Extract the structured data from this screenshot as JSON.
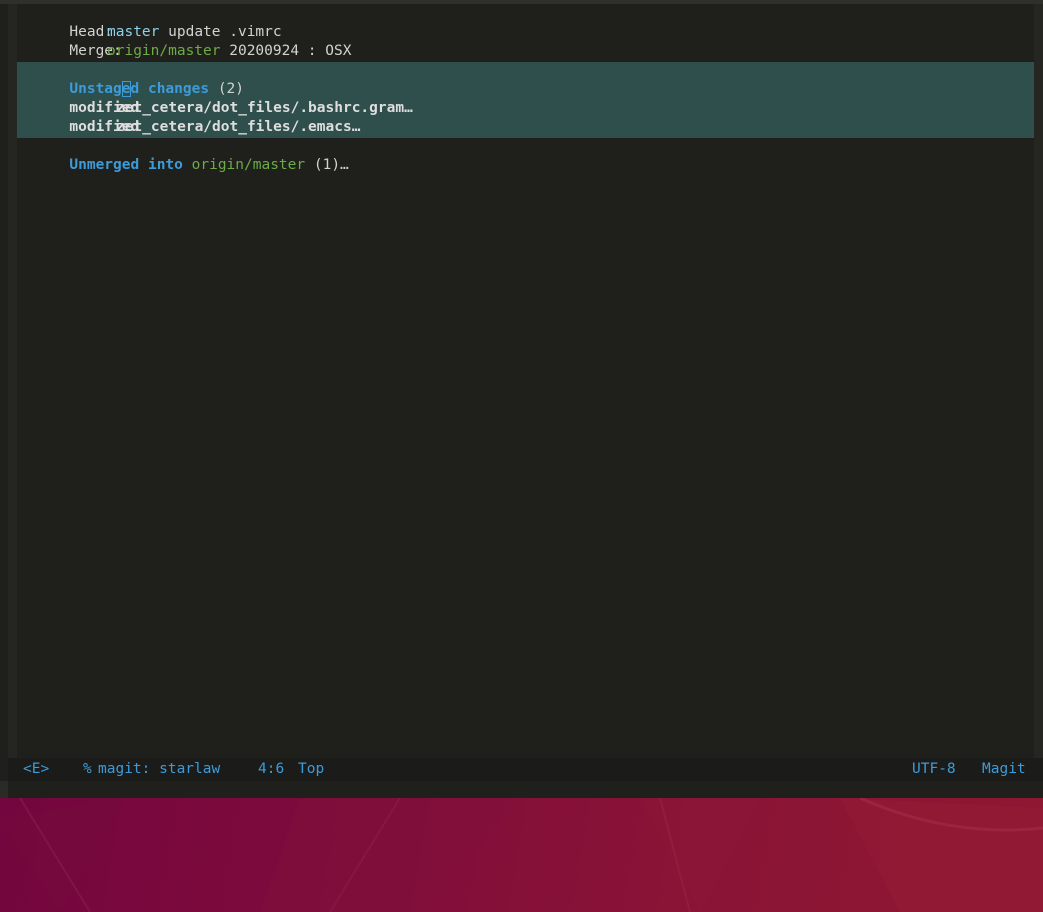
{
  "status": {
    "head_label": "Head:",
    "head_branch": "master",
    "head_message": "update .vimrc",
    "merge_label": "Merge:",
    "merge_branch": "origin/master",
    "merge_message": "20200924 : OSX"
  },
  "unstaged": {
    "title_a": "Unstag",
    "title_cursor": "e",
    "title_b": "d changes",
    "count": "(2)",
    "items": [
      {
        "status": "modified",
        "path": "zet_cetera/dot_files/.bashrc.gram…"
      },
      {
        "status": "modified",
        "path": "zet_cetera/dot_files/.emacs…"
      }
    ]
  },
  "unmerged": {
    "title": "Unmerged into",
    "branch": "origin/master",
    "count": "(1)…"
  },
  "mode_line": {
    "evil_state": "<E>",
    "modified": "%",
    "buffer_name": "magit: starlaw",
    "position": "4:6",
    "scroll": "Top",
    "encoding": "UTF-8",
    "major_mode": "Magit"
  },
  "colors": {
    "background": "#1f201c",
    "highlight": "#2f4f4d",
    "section_heading": "#3d9bd8",
    "local_branch": "#8ed1e8",
    "remote_branch": "#6cab45"
  }
}
